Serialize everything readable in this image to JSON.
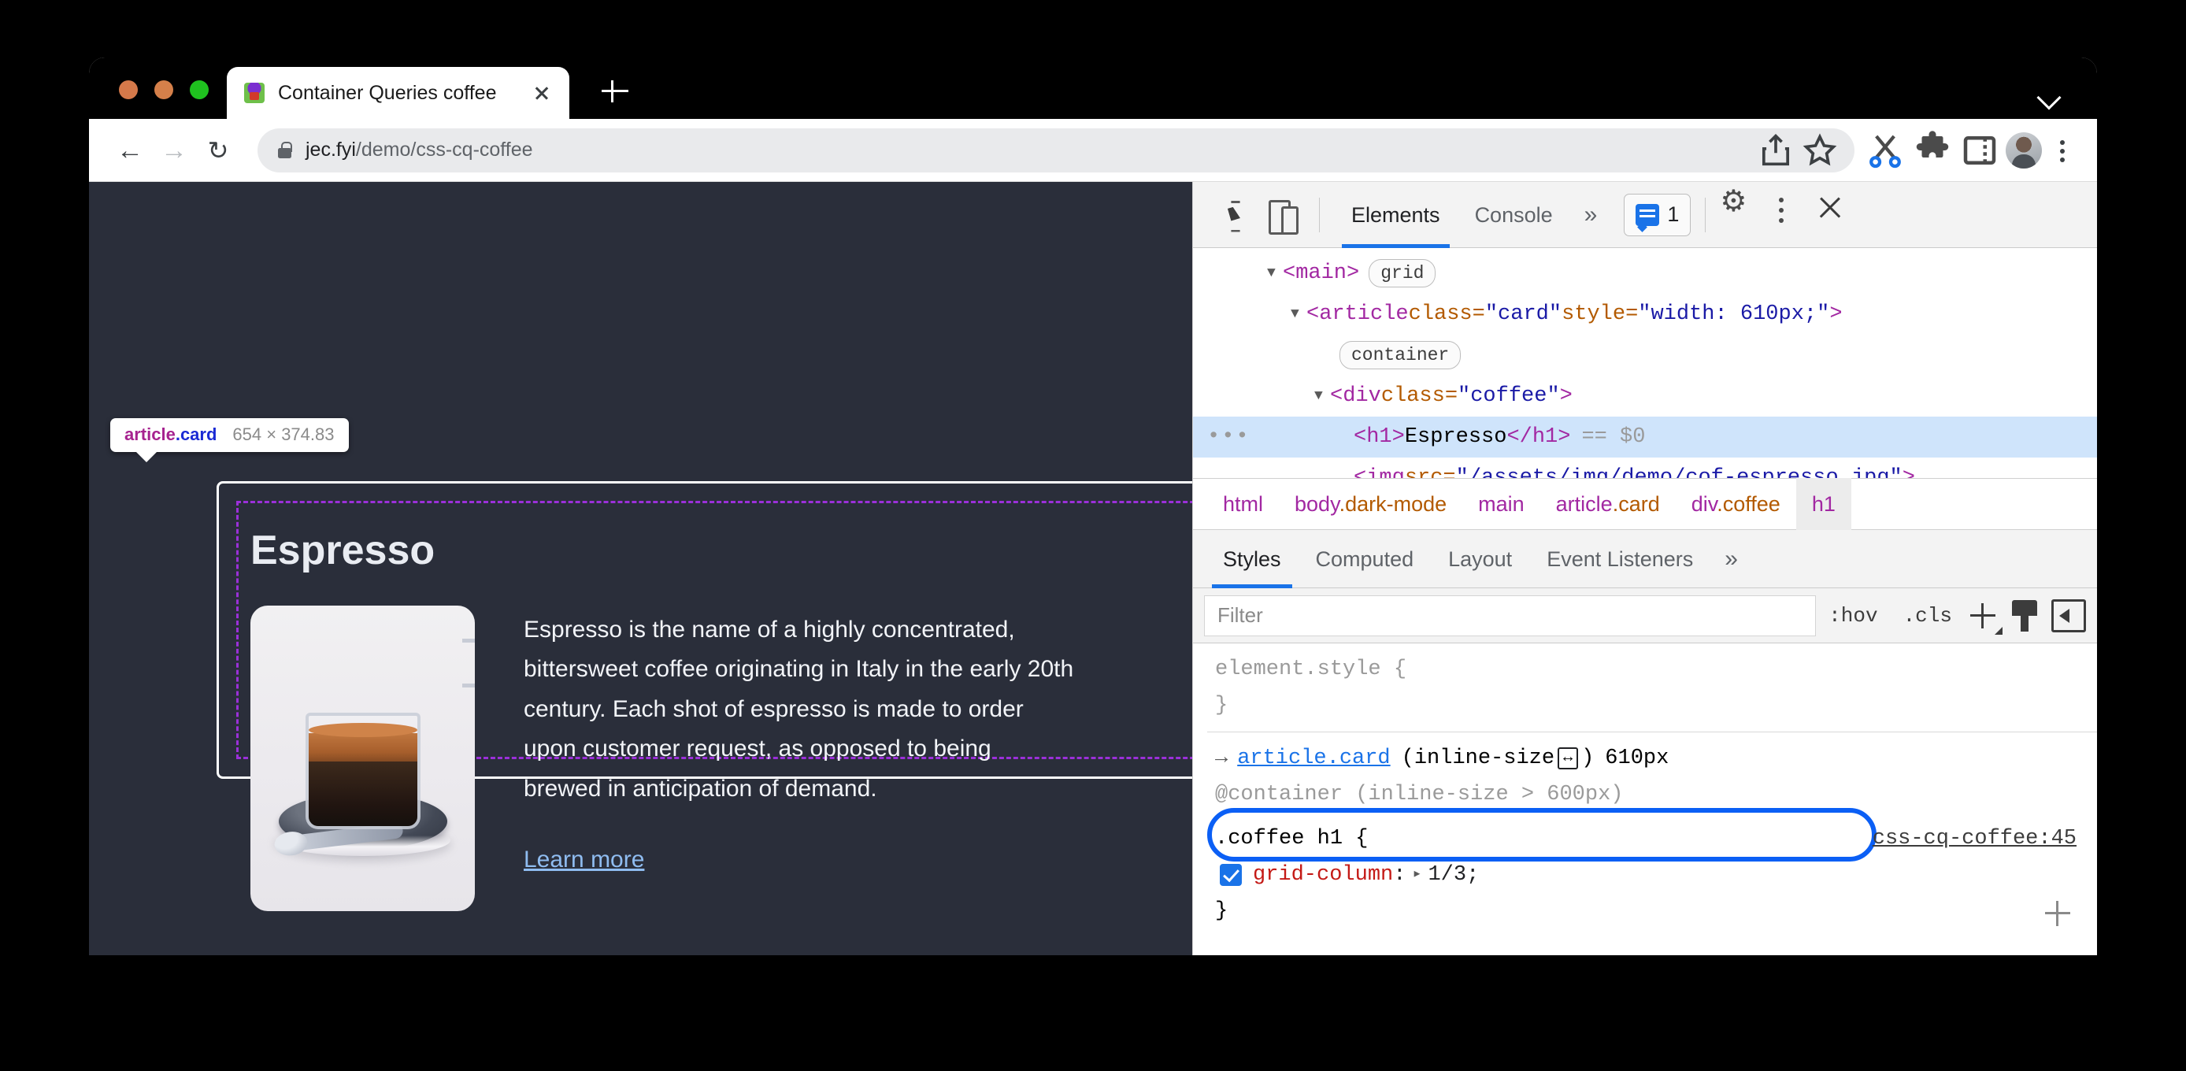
{
  "browser": {
    "tab": {
      "title": "Container Queries coffee",
      "favicon": "page-favicon",
      "close_label": "×"
    },
    "new_tab_label": "+",
    "omnibox": {
      "url_host": "jec.fyi",
      "url_path": "/demo/css-cq-coffee",
      "security": "lock-icon"
    },
    "toolbar_icons": [
      "share-icon",
      "bookmark-star-icon",
      "scissors-icon",
      "extensions-puzzle-icon",
      "side-panel-icon",
      "profile-avatar",
      "browser-menu-dots"
    ],
    "nav": {
      "back": "←",
      "forward": "→",
      "reload": "↻"
    }
  },
  "page": {
    "inspect_badge": {
      "tag": "article",
      "cls": ".card",
      "dimensions": "654 × 374.83"
    },
    "card": {
      "title": "Espresso",
      "body": "Espresso is the name of a highly concentrated, bittersweet coffee originating in Italy in the early 20th century. Each shot of espresso is made to order upon customer request, as opposed to being brewed in anticipation of demand.",
      "link": "Learn more",
      "image_alt": "espresso-cup-image"
    }
  },
  "devtools": {
    "toolbar": {
      "tabs": [
        {
          "label": "Elements",
          "active": true
        },
        {
          "label": "Console",
          "active": false
        }
      ],
      "more_tabs": "»",
      "issues_count": "1",
      "icons": [
        "inspect-cursor-icon",
        "device-toggle-icon",
        "issues-icon",
        "gear-icon",
        "devtools-menu-dots",
        "devtools-close-icon"
      ]
    },
    "dom_tree": [
      {
        "indent": 1,
        "triangle": "▼",
        "selected": false,
        "ellipsis": false,
        "parts": [
          {
            "t": "punct",
            "v": "<"
          },
          {
            "t": "tag",
            "v": "main"
          },
          {
            "t": "punct",
            "v": ">"
          }
        ],
        "pill": "grid"
      },
      {
        "indent": 2,
        "triangle": "▼",
        "selected": false,
        "ellipsis": false,
        "parts": [
          {
            "t": "punct",
            "v": "<"
          },
          {
            "t": "tag",
            "v": "article"
          },
          {
            "t": "plain",
            "v": " "
          },
          {
            "t": "attr-name",
            "v": "class"
          },
          {
            "t": "punct2",
            "v": "="
          },
          {
            "t": "attr-val",
            "v": "\"card\""
          },
          {
            "t": "plain",
            "v": " "
          },
          {
            "t": "attr-name",
            "v": "style"
          },
          {
            "t": "punct2",
            "v": "="
          },
          {
            "t": "attr-val",
            "v": "\"width: 610px;\""
          },
          {
            "t": "punct",
            "v": ">"
          }
        ],
        "pill": null
      },
      {
        "indent": 3,
        "triangle": "",
        "selected": false,
        "ellipsis": false,
        "parts": [],
        "pill": "container"
      },
      {
        "indent": 3,
        "triangle": "▼",
        "selected": false,
        "ellipsis": false,
        "parts": [
          {
            "t": "punct",
            "v": "<"
          },
          {
            "t": "tag",
            "v": "div"
          },
          {
            "t": "plain",
            "v": " "
          },
          {
            "t": "attr-name",
            "v": "class"
          },
          {
            "t": "punct2",
            "v": "="
          },
          {
            "t": "attr-val",
            "v": "\"coffee\""
          },
          {
            "t": "punct",
            "v": ">"
          }
        ],
        "pill": null
      },
      {
        "indent": 4,
        "triangle": "",
        "selected": true,
        "ellipsis": true,
        "parts": [
          {
            "t": "punct",
            "v": "<"
          },
          {
            "t": "tag",
            "v": "h1"
          },
          {
            "t": "punct",
            "v": ">"
          },
          {
            "t": "text",
            "v": "Espresso"
          },
          {
            "t": "punct",
            "v": "</"
          },
          {
            "t": "tag",
            "v": "h1"
          },
          {
            "t": "punct",
            "v": ">"
          }
        ],
        "pill": null,
        "suffix": "== $0"
      },
      {
        "indent": 4,
        "triangle": "",
        "selected": false,
        "ellipsis": false,
        "parts": [
          {
            "t": "punct",
            "v": "<"
          },
          {
            "t": "tag",
            "v": "img"
          },
          {
            "t": "plain",
            "v": " "
          },
          {
            "t": "attr-name",
            "v": "src"
          },
          {
            "t": "punct2",
            "v": "="
          },
          {
            "t": "attr-val",
            "v": "\""
          },
          {
            "t": "link",
            "v": "/assets/img/demo/cof-espresso.jpg"
          },
          {
            "t": "attr-val",
            "v": "\""
          },
          {
            "t": "punct",
            "v": ">"
          }
        ],
        "pill": null
      }
    ],
    "breadcrumb": [
      {
        "label": "html",
        "cls": "",
        "active": false
      },
      {
        "label": "body",
        "cls": ".dark-mode",
        "active": false
      },
      {
        "label": "main",
        "cls": "",
        "active": false
      },
      {
        "label": "article",
        "cls": ".card",
        "active": false
      },
      {
        "label": "div",
        "cls": ".coffee",
        "active": false
      },
      {
        "label": "h1",
        "cls": "",
        "active": true
      }
    ],
    "styles_tabs": [
      {
        "label": "Styles",
        "active": true
      },
      {
        "label": "Computed",
        "active": false
      },
      {
        "label": "Layout",
        "active": false
      },
      {
        "label": "Event Listeners",
        "active": false
      }
    ],
    "styles_more": "»",
    "filter": {
      "placeholder": "Filter",
      "value": ""
    },
    "filter_actions": {
      "hov": ":hov",
      "cls": ".cls",
      "new_rule": "plus-icon",
      "color_picker": "brush-icon",
      "sidebar": "sidebar-toggle-icon"
    },
    "css_rules": {
      "element_style": {
        "selector": "element.style {",
        "close": "}"
      },
      "container_query": {
        "arrow": "→",
        "link": "article.card",
        "condition_open": "(inline-size",
        "size_glyph": "↔",
        "condition_close": ")",
        "value": "610px",
        "at_rule": "@container (inline-size > 600px)",
        "highlighted": true,
        "highlight_color": "#0b5ff5"
      },
      "rule": {
        "selector": ".coffee h1 {",
        "source": "css-cq-coffee:45",
        "declarations": [
          {
            "enabled": true,
            "name": "grid-column",
            "expander": "▸",
            "value": "1/3;"
          }
        ],
        "close": "}"
      }
    }
  }
}
